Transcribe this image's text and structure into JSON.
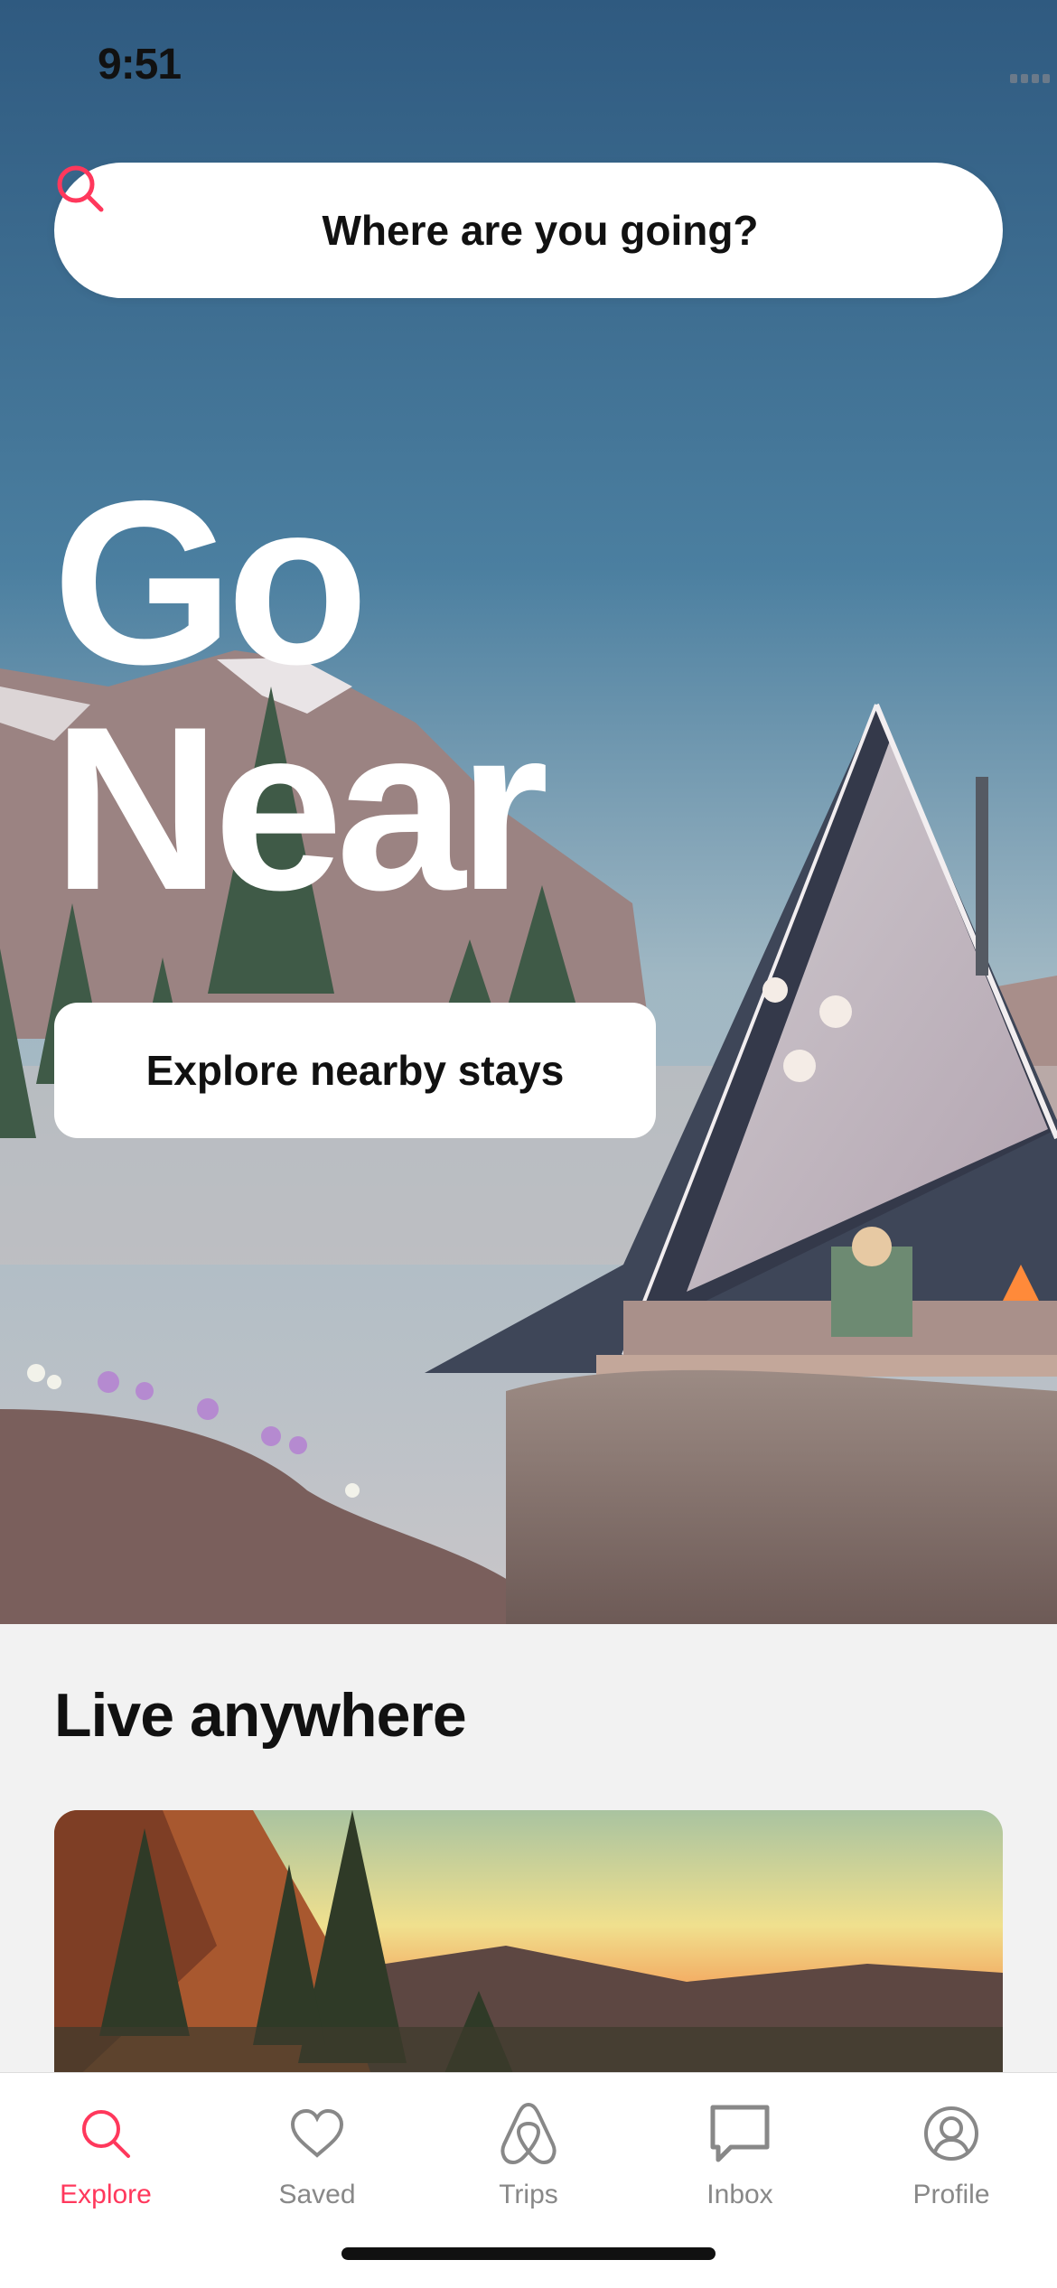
{
  "status": {
    "time": "9:51"
  },
  "search": {
    "label": "Where are you going?"
  },
  "hero": {
    "line1": "Go",
    "line2": "Near",
    "cta": "Explore nearby stays"
  },
  "section": {
    "title": "Live anywhere"
  },
  "tabs": [
    {
      "label": "Explore",
      "icon": "search-icon",
      "active": true
    },
    {
      "label": "Saved",
      "icon": "heart-icon",
      "active": false
    },
    {
      "label": "Trips",
      "icon": "airbnb-logo-icon",
      "active": false
    },
    {
      "label": "Inbox",
      "icon": "message-icon",
      "active": false
    },
    {
      "label": "Profile",
      "icon": "profile-icon",
      "active": false
    }
  ],
  "colors": {
    "accent": "#ff385c",
    "tab_inactive": "#888888"
  }
}
